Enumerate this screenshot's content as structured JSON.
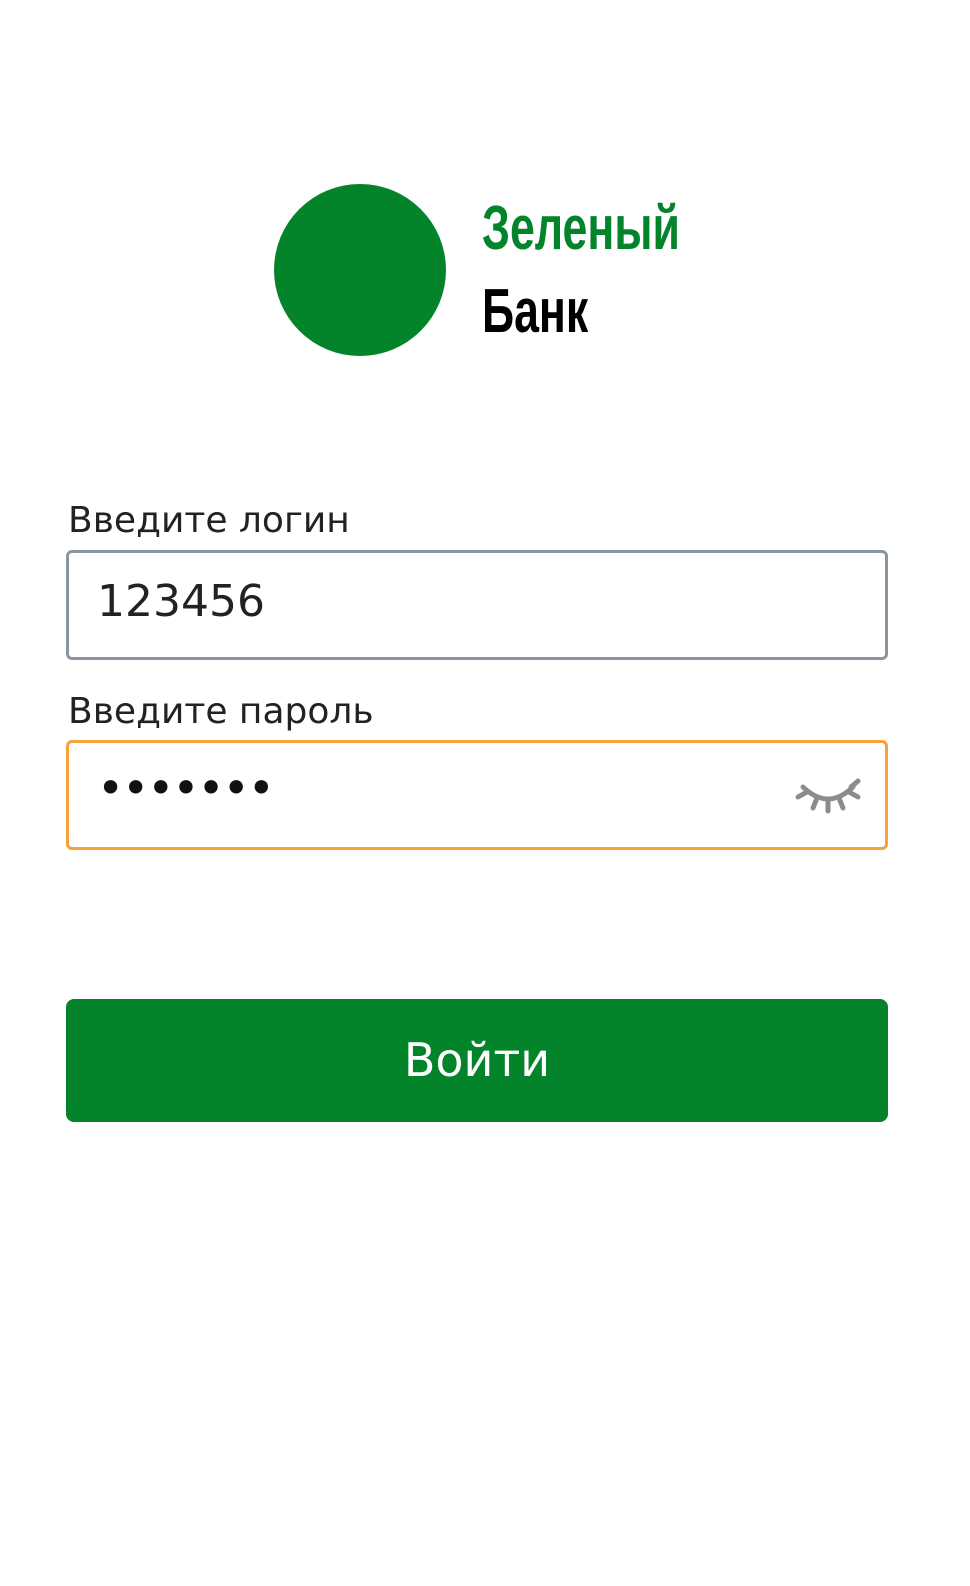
{
  "brand": {
    "line1": "Зеленый",
    "line2": "Банк",
    "colors": {
      "green": "#03842a",
      "text": "#000000"
    }
  },
  "form": {
    "login": {
      "label": "Введите логин",
      "value": "123456"
    },
    "password": {
      "label": "Введите пароль",
      "masked_value": "•••••••",
      "toggle_icon": "eye-closed-icon",
      "focused": true
    },
    "submit_label": "Войти"
  },
  "colors": {
    "accent_focus": "#f4a23c",
    "input_border": "#8996a2",
    "button_bg": "#03842a"
  }
}
